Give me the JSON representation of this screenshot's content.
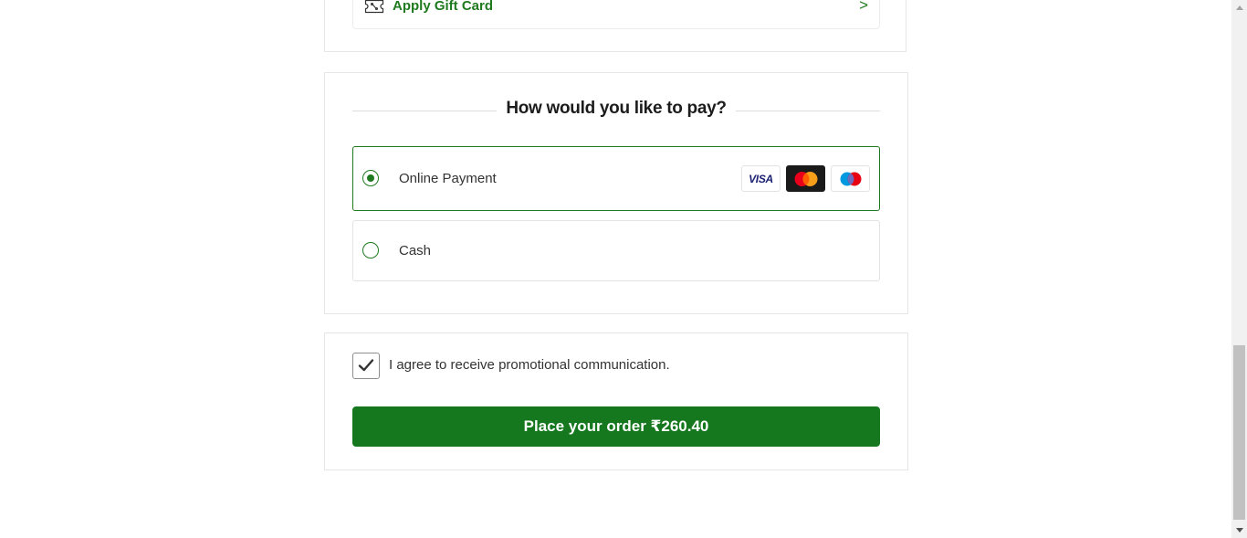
{
  "gift_card": {
    "label": "Apply Gift Card",
    "chevron": ">",
    "icon": "gift-card-icon"
  },
  "payment": {
    "heading": "How would you like to pay?",
    "options": [
      {
        "label": "Online Payment",
        "selected": true
      },
      {
        "label": "Cash",
        "selected": false
      }
    ],
    "cards": [
      {
        "name": "VISA",
        "icon": "visa-icon"
      },
      {
        "name": "Mastercard",
        "icon": "mastercard-icon"
      },
      {
        "name": "Maestro",
        "icon": "maestro-icon"
      }
    ]
  },
  "agree": {
    "checked": true,
    "text": "I agree to receive promotional communication."
  },
  "order": {
    "button_label": "Place your order ₹260.40"
  },
  "colors": {
    "brand_green": "#16781e",
    "border": "#e6e6e6"
  }
}
